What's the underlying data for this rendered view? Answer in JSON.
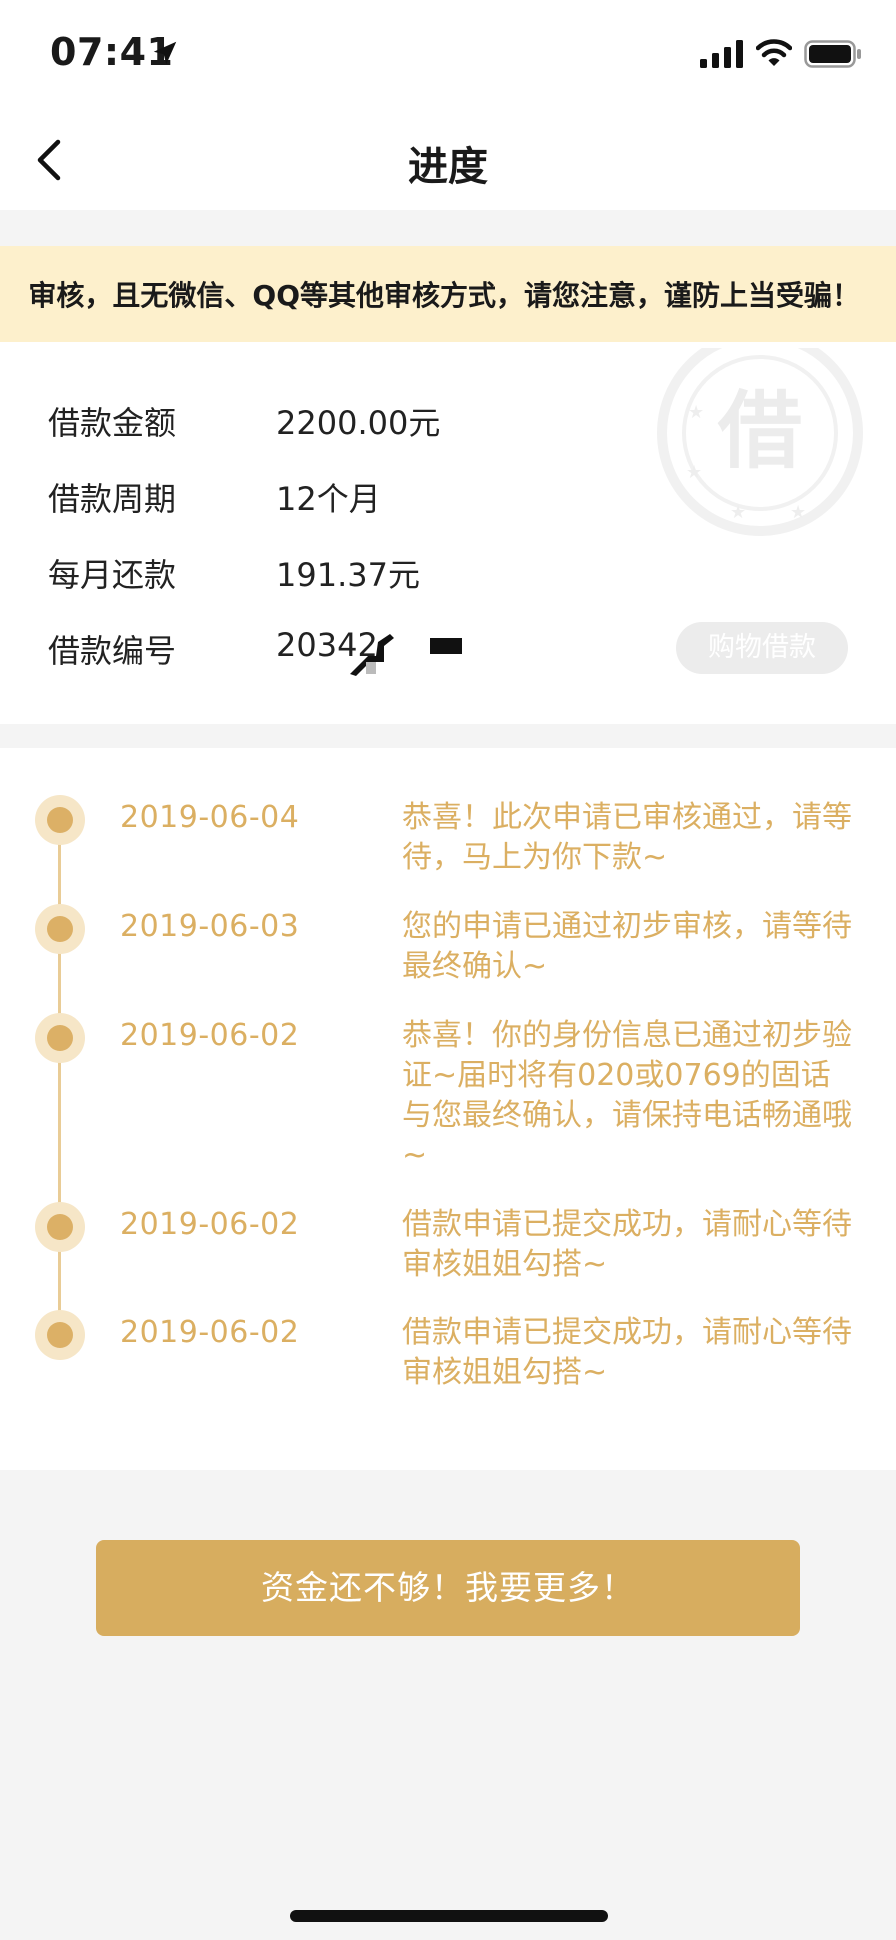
{
  "status_bar": {
    "time": "07:41"
  },
  "nav": {
    "title": "进度"
  },
  "notice": {
    "text": "审核，且无微信、QQ等其他审核方式，请您注意，谨防上当受骗！"
  },
  "loan_info": {
    "rows": [
      {
        "label": "借款金额",
        "value": "2200.00元"
      },
      {
        "label": "借款周期",
        "value": "12个月"
      },
      {
        "label": "每月还款",
        "value": "191.37元"
      },
      {
        "label": "借款编号",
        "value": "20342"
      }
    ],
    "stamp_char": "借",
    "tag": "购物借款"
  },
  "timeline": [
    {
      "date": "2019-06-04",
      "text": "恭喜！此次申请已审核通过，请等待，马上为你下款~"
    },
    {
      "date": "2019-06-03",
      "text": "您的申请已通过初步审核，请等待最终确认~"
    },
    {
      "date": "2019-06-02",
      "text": "恭喜！你的身份信息已通过初步验证~届时将有020或0769的固话与您最终确认，请保持电话畅通哦~"
    },
    {
      "date": "2019-06-02",
      "text": "借款申请已提交成功，请耐心等待审核姐姐勾搭~"
    },
    {
      "date": "2019-06-02",
      "text": "借款申请已提交成功，请耐心等待审核姐姐勾搭~"
    }
  ],
  "cta": {
    "label": "资金还不够！我要更多！"
  },
  "colors": {
    "accent": "#d7ad5f",
    "timeline_text": "#dbaf62",
    "notice_bg": "#fdf0cc"
  },
  "icons": [
    "location-arrow-icon",
    "signal-icon",
    "wifi-icon",
    "battery-icon",
    "back-chevron-icon",
    "stamp-icon"
  ]
}
